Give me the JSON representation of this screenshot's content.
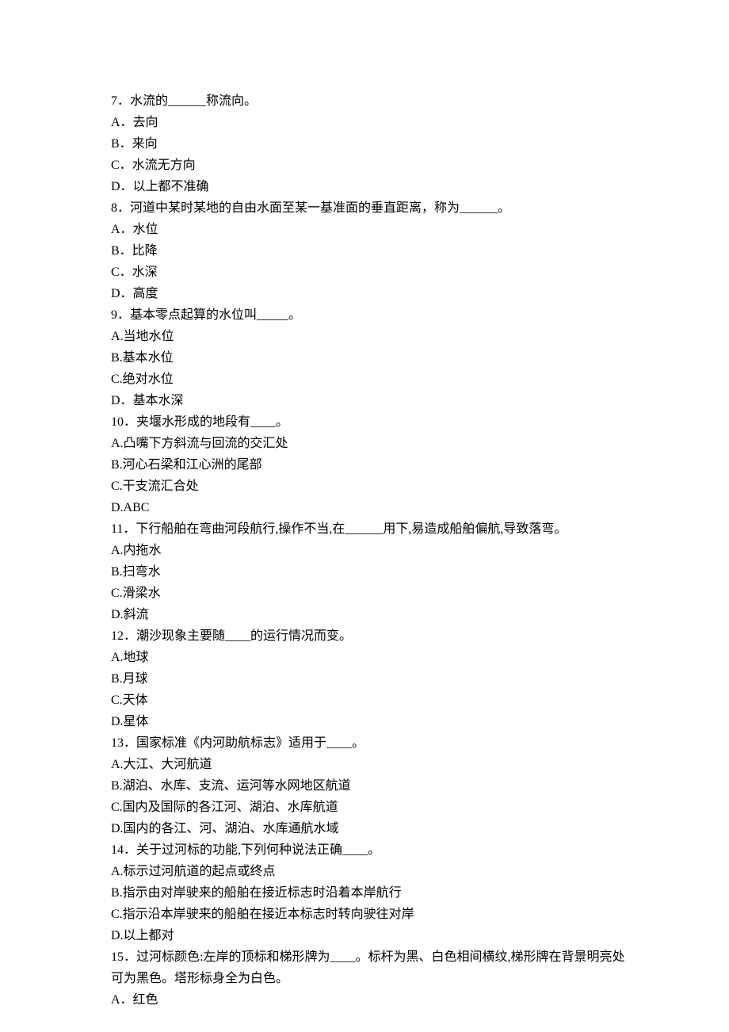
{
  "questions": [
    {
      "stem": "7．水流的______称流向。",
      "options": [
        "A．去向",
        "B．来向",
        "C．水流无方向",
        "D．以上都不准确"
      ]
    },
    {
      "stem": "8．河道中某时某地的自由水面至某一基准面的垂直距离，称为______。",
      "options": [
        "A．水位",
        "B．比降",
        "C．水深",
        "D．高度"
      ]
    },
    {
      "stem": "9．基本零点起算的水位叫_____。",
      "options": [
        "A.当地水位",
        "B.基本水位",
        "C.绝对水位",
        "D．基本水深"
      ]
    },
    {
      "stem": "10．夹堰水形成的地段有____。",
      "options": [
        "A.凸嘴下方斜流与回流的交汇处",
        "B.河心石梁和江心洲的尾部",
        "C.干支流汇合处",
        "D.ABC"
      ]
    },
    {
      "stem": "11．下行船舶在弯曲河段航行,操作不当,在______用下,易造成船舶偏航,导致落弯。",
      "options": [
        "A.内拖水",
        "B.扫弯水",
        "C.滑梁水",
        "D.斜流"
      ]
    },
    {
      "stem": "12．潮沙现象主要随____的运行情况而变。",
      "options": [
        "A.地球",
        "B.月球",
        "C.天体",
        "D.星体"
      ]
    },
    {
      "stem": "13．国家标准《内河助航标志》适用于____。",
      "options": [
        "A.大江、大河航道",
        "B.湖泊、水库、支流、运河等水网地区航道",
        "C.国内及国际的各江河、湖泊、水库航道",
        "D.国内的各江、河、湖泊、水库通航水域"
      ]
    },
    {
      "stem": "14．关于过河标的功能,下列何种说法正确____。",
      "options": [
        "A.标示过河航道的起点或终点",
        "B.指示由对岸驶来的船舶在接近标志时沿着本岸航行",
        "C.指示沿本岸驶来的船舶在接近本标志时转向驶往对岸",
        "D.以上都对"
      ]
    },
    {
      "stem": "15．过河标颜色:左岸的顶标和梯形牌为____。标杆为黑、白色相间横纹,梯形牌在背景明亮处可为黑色。塔形标身全为白色。",
      "options": [
        "A．红色"
      ]
    }
  ]
}
